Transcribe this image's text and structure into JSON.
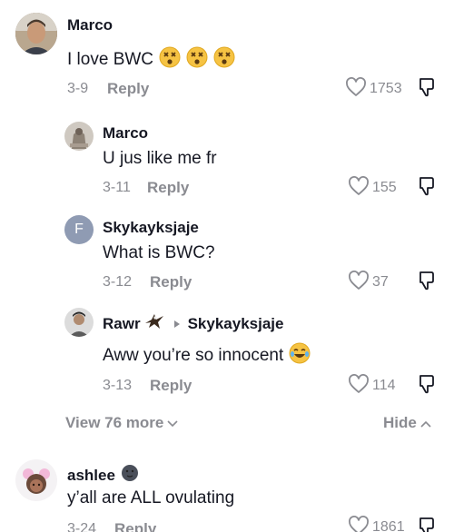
{
  "comments": [
    {
      "author": "Marco",
      "text": "I love BWC",
      "date": "3-9",
      "reply_label": "Reply",
      "likes": "1753"
    },
    {
      "author": "Marco",
      "text": "U jus like me fr",
      "date": "3-11",
      "reply_label": "Reply",
      "likes": "155"
    },
    {
      "author": "Skykayksjaje",
      "avatar_letter": "F",
      "text": "What is BWC?",
      "date": "3-12",
      "reply_label": "Reply",
      "likes": "37"
    },
    {
      "author": "Rawr",
      "reply_to": "Skykayksjaje",
      "text": "Aww you’re so innocent",
      "date": "3-13",
      "reply_label": "Reply",
      "likes": "114"
    },
    {
      "author": "ashlee",
      "text": "y’all are ALL ovulating",
      "date": "3-24",
      "reply_label": "Reply",
      "likes": "1861"
    }
  ],
  "thread": {
    "view_more_label": "View 76 more",
    "hide_label": "Hide"
  },
  "colors": {
    "text": "#161823",
    "muted": "#8a8b91",
    "avatar_f": "#8f9bb3"
  }
}
